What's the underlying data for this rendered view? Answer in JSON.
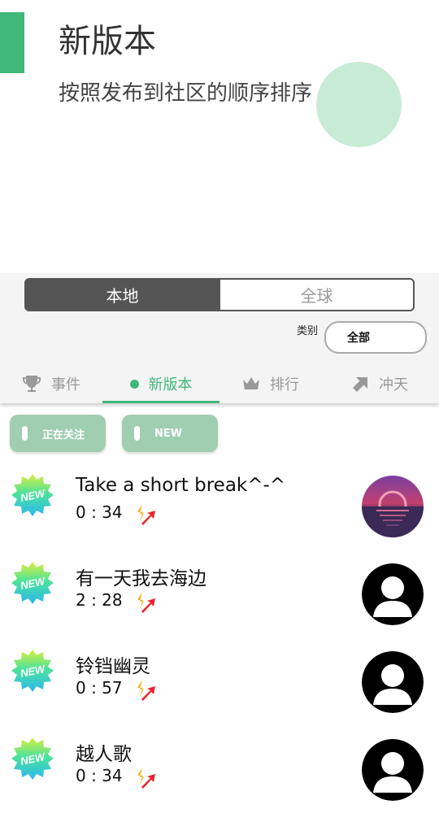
{
  "tip": {
    "title": "新版本",
    "description": "按照发布到社区的顺序排序"
  },
  "scope": {
    "local_label": "本地",
    "global_label": "全球",
    "selected": "本地"
  },
  "category": {
    "label": "类别",
    "value": "全部"
  },
  "tabs": [
    {
      "label": "事件",
      "icon": "trophy-icon"
    },
    {
      "label": "新版本",
      "icon": "dot-icon",
      "active": true
    },
    {
      "label": "排行",
      "icon": "crown-icon"
    },
    {
      "label": "冲天",
      "icon": "arrow-up-right-icon"
    }
  ],
  "chips": [
    {
      "label": "正在关注"
    },
    {
      "label": "NEW"
    }
  ],
  "badge_text": "NEW",
  "songs": [
    {
      "title": "Take a short break^-^",
      "duration": "0 : 34",
      "avatar": "sunset-avatar"
    },
    {
      "title": "有一天我去海边",
      "duration": "2 : 28",
      "avatar": "default-avatar"
    },
    {
      "title": "铃铛幽灵",
      "duration": "0 : 57",
      "avatar": "default-avatar"
    },
    {
      "title": "越人歌",
      "duration": "0 : 34",
      "avatar": "default-avatar"
    }
  ],
  "colors": {
    "accent": "#3fb87a",
    "chip": "#9fcfb0",
    "segment_selected": "#555555"
  }
}
